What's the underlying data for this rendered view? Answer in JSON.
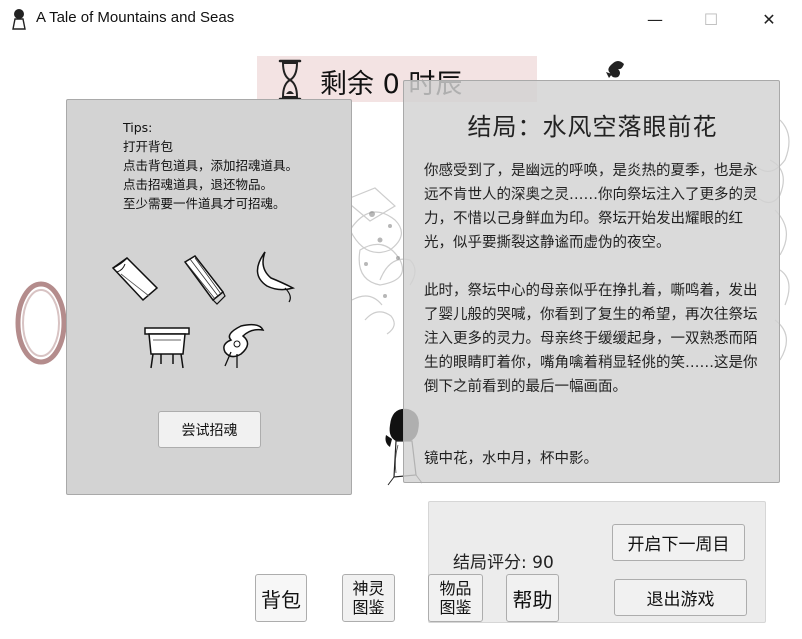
{
  "window": {
    "title": "A Tale of Mountains and Seas",
    "minimize": "—",
    "maximize": "☐",
    "close": "✕"
  },
  "time": {
    "text": "剩余 0 时辰"
  },
  "tips": {
    "lines": [
      "Tips:",
      "打开背包",
      "点击背包道具，添加招魂道具。",
      "点击招魂道具，退还物品。",
      "至少需要一件道具才可招魂。"
    ],
    "summon_button": "尝试招魂",
    "items": [
      "bamboo-scroll-icon",
      "bamboo-slips-icon",
      "feather-leaf-icon",
      "bronze-cauldron-icon",
      "jade-ornament-icon"
    ]
  },
  "ending": {
    "title": "结局：水风空落眼前花",
    "paragraph1": "你感受到了，是幽远的呼唤，是炎热的夏季，也是永远不肯世人的深奥之灵……你向祭坛注入了更多的灵力，不惜以己身鲜血为印。祭坛开始发出耀眼的红光，似乎要撕裂这静谧而虚伪的夜空。",
    "paragraph2": "此时，祭坛中心的母亲似乎在挣扎着，嘶鸣着，发出了婴儿般的哭喊，你看到了复生的希望，再次往祭坛注入更多的灵力。母亲终于缓缓起身，一双熟悉而陌生的眼睛盯着你，嘴角噙着稍显轻佻的笑……这是你倒下之前看到的最后一幅画面。",
    "paragraph3": "镜中花，水中月，杯中影。"
  },
  "score": {
    "label": "结局评分: 90",
    "next_cycle_button": "开启下一周目",
    "exit_button": "退出游戏"
  },
  "toolbar": {
    "bag": "背包",
    "deity_line1": "神灵",
    "deity_line2": "图鉴",
    "items_line1": "物品",
    "items_line2": "图鉴",
    "help": "帮助"
  },
  "colors": {
    "panel_gray": "#d3d3d3",
    "time_banner": "#f3e3e3",
    "portal_ring": "#b48c8c"
  }
}
